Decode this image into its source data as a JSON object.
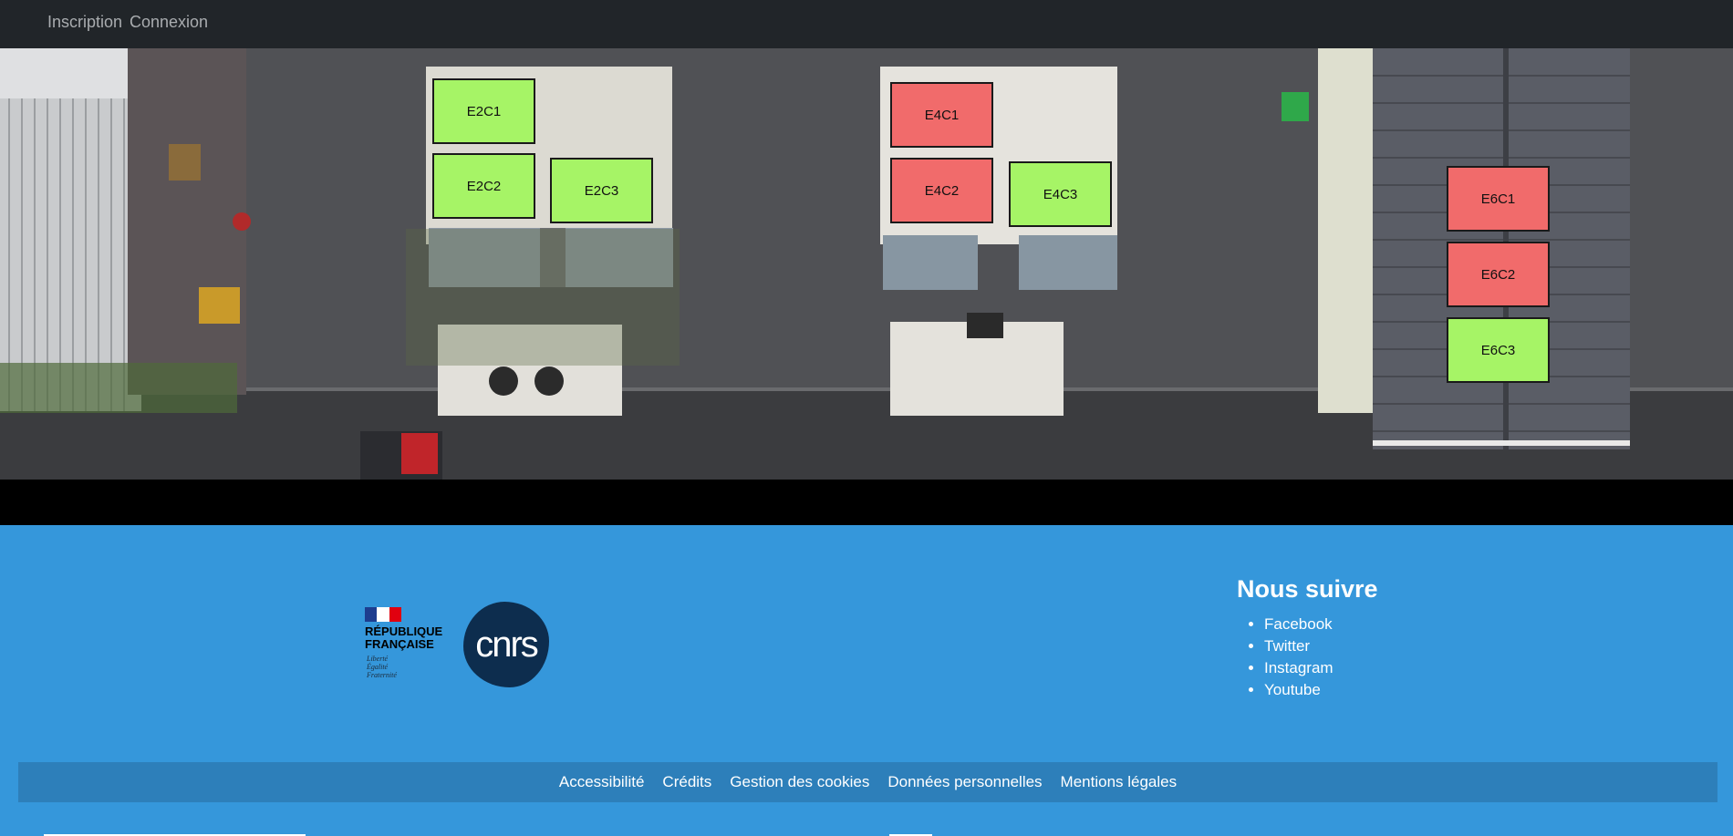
{
  "nav": {
    "links": [
      "Inscription",
      "Connexion"
    ]
  },
  "slots": [
    {
      "id": "E2C1",
      "status": "free"
    },
    {
      "id": "E2C2",
      "status": "free"
    },
    {
      "id": "E2C3",
      "status": "free"
    },
    {
      "id": "E4C1",
      "status": "busy"
    },
    {
      "id": "E4C2",
      "status": "busy"
    },
    {
      "id": "E4C3",
      "status": "free"
    },
    {
      "id": "E6C1",
      "status": "busy"
    },
    {
      "id": "E6C2",
      "status": "busy"
    },
    {
      "id": "E6C3",
      "status": "free"
    }
  ],
  "status_colors": {
    "free": "#a6f466",
    "busy": "#f16b6b"
  },
  "footer": {
    "rf_logo": {
      "line1": "RÉPUBLIQUE",
      "line2": "FRANÇAISE",
      "motto1": "Liberté",
      "motto2": "Égalité",
      "motto3": "Fraternité"
    },
    "cnrs_logo": {
      "text": "cnrs"
    },
    "follow_title": "Nous suivre",
    "social": [
      "Facebook",
      "Twitter",
      "Instagram",
      "Youtube"
    ],
    "legal": [
      "Accessibilité",
      "Crédits",
      "Gestion des cookies",
      "Données personnelles",
      "Mentions légales"
    ]
  },
  "colors": {
    "navbar": "#212529",
    "footer": "#3597db",
    "legal_bar": "#2d7fba"
  }
}
